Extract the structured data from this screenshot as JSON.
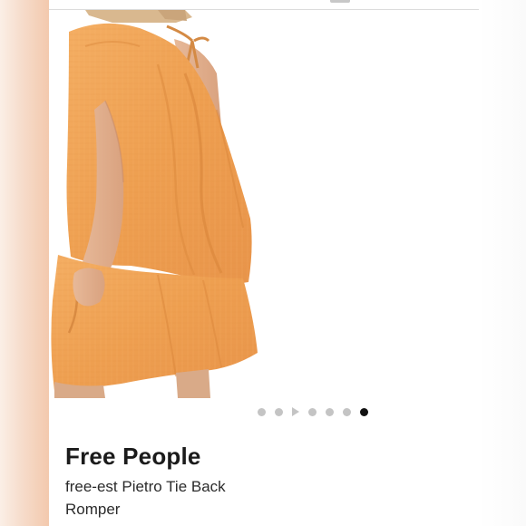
{
  "product": {
    "brand": "Free People",
    "name": "free-est Pietro Tie Back Romper",
    "image_icon": "product-photo",
    "colors": {
      "garment": "#f1a45b",
      "brand_text": "#1b1b1b",
      "dot_inactive": "#c4c4c4",
      "dot_active": "#111111"
    }
  },
  "carousel": {
    "items": [
      {
        "type": "dot",
        "active": false
      },
      {
        "type": "dot",
        "active": false
      },
      {
        "type": "play",
        "active": false
      },
      {
        "type": "dot",
        "active": false
      },
      {
        "type": "dot",
        "active": false
      },
      {
        "type": "dot",
        "active": false
      },
      {
        "type": "dot",
        "active": true
      }
    ],
    "current_index": 7,
    "total": 7
  }
}
